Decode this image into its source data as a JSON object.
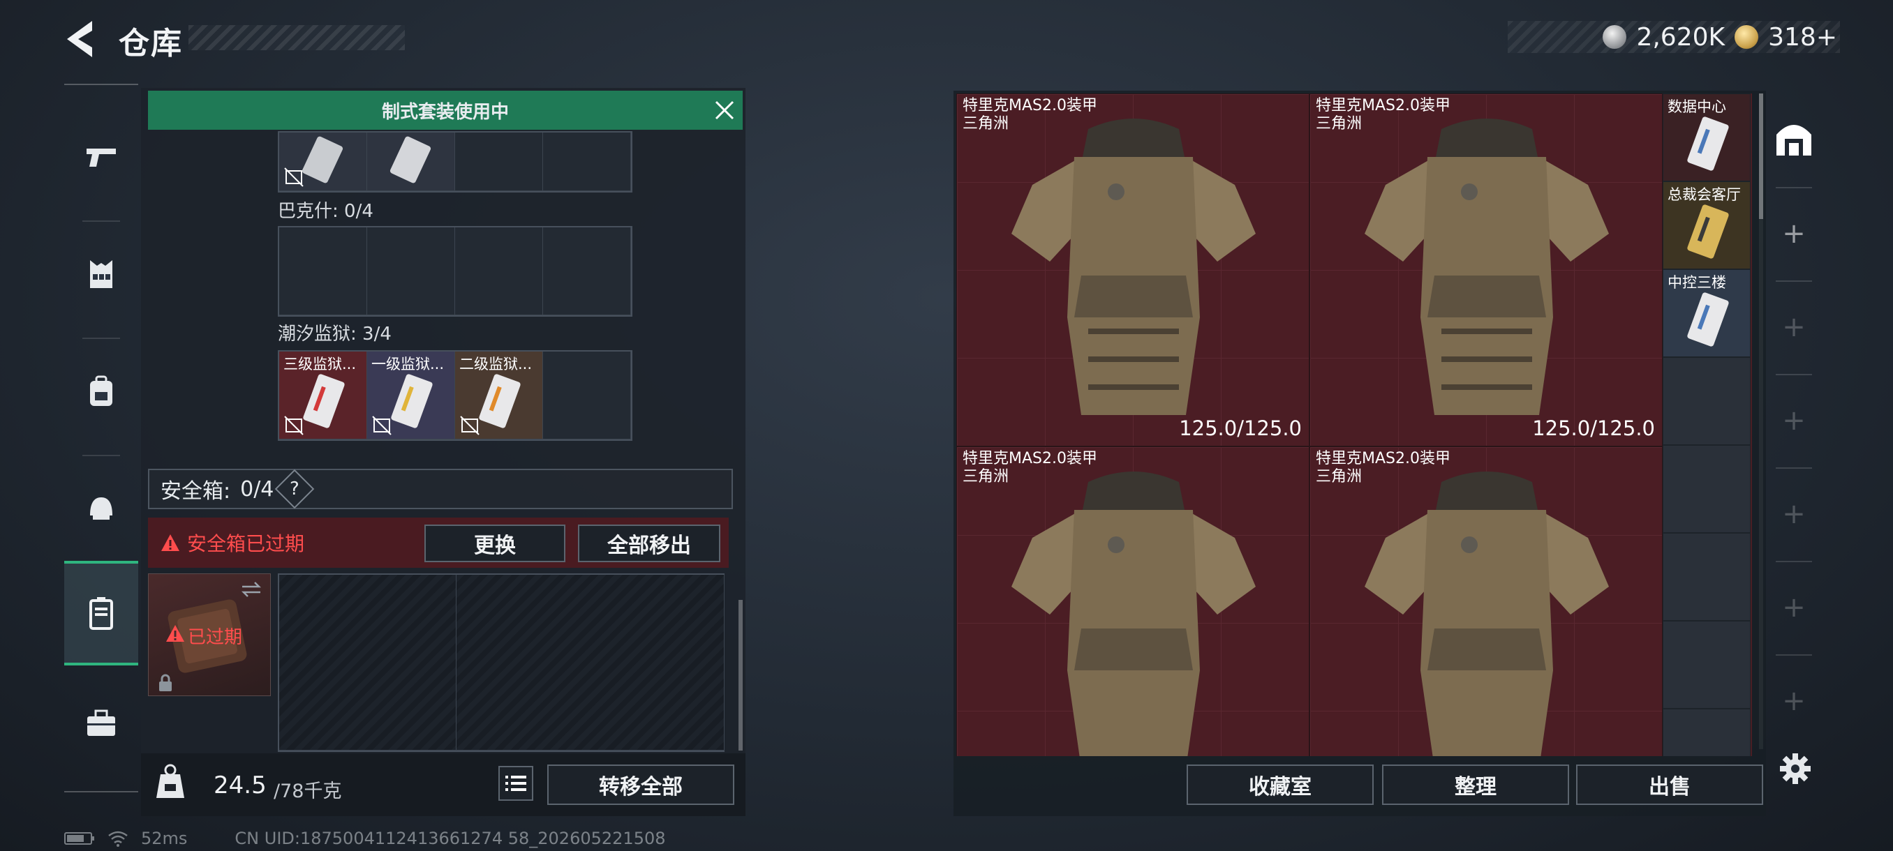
{
  "header": {
    "title": "仓库",
    "currency": [
      {
        "icon": "silver-coin-icon",
        "value": "2,620K"
      },
      {
        "icon": "gold-coin-icon",
        "value": "318+"
      }
    ]
  },
  "nav": {
    "items": [
      {
        "name": "weapon",
        "icon": "pistol-icon"
      },
      {
        "name": "vest",
        "icon": "chest-rig-icon"
      },
      {
        "name": "backpack",
        "icon": "backpack-icon"
      },
      {
        "name": "helmet",
        "icon": "helmet-icon"
      },
      {
        "name": "safebox",
        "icon": "safebox-icon",
        "active": true
      },
      {
        "name": "toolbox",
        "icon": "toolbox-icon"
      }
    ]
  },
  "kit_banner": {
    "label": "制式套装使用中"
  },
  "key_sections": [
    {
      "label": "巴克什: 0/4",
      "cards": []
    },
    {
      "label": "潮汐监狱: 3/4",
      "cards": [
        "三级监狱...",
        "一级监狱...",
        "二级监狱..."
      ]
    }
  ],
  "safebox": {
    "label": "安全箱:",
    "count": "0/4",
    "help": "?",
    "warning": "安全箱已过期",
    "replace_button": "更换",
    "move_all_out_button": "全部移出",
    "item_status": "已过期"
  },
  "weight": {
    "current": "24.5",
    "max": "/78千克",
    "transfer_all_button": "转移全部"
  },
  "stash": {
    "armors": [
      {
        "name": "特里克MAS2.0装甲",
        "tag": "三角洲",
        "durability": "125.0/125.0"
      },
      {
        "name": "特里克MAS2.0装甲",
        "tag": "三角洲",
        "durability": "125.0/125.0"
      },
      {
        "name": "特里克MAS2.0装甲",
        "tag": "三角洲"
      },
      {
        "name": "特里克MAS2.0装甲",
        "tag": "三角洲"
      }
    ],
    "keys": [
      {
        "name": "数据中心",
        "color": "#3a2a22"
      },
      {
        "name": "总裁会客厅",
        "color": "#3d3422"
      },
      {
        "name": "中控三楼",
        "color": "#2f3a4a"
      }
    ],
    "buttons": {
      "collection": "收藏室",
      "sort": "整理",
      "sell": "出售"
    }
  },
  "status": {
    "ping": "52ms",
    "uid": "CN UID:1875004112413661274 58_202605221508"
  },
  "colors": {
    "accent_green": "#1f7a56",
    "warning_red": "#ff4d4d",
    "stash_bg": "#4b1d24"
  }
}
